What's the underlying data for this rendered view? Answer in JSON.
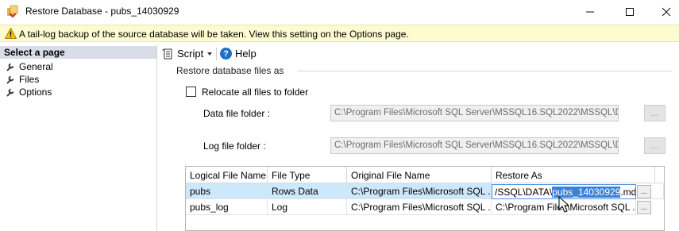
{
  "window": {
    "title": "Restore Database - pubs_14030929",
    "controls": [
      "—",
      "☐",
      "✕"
    ]
  },
  "banner": {
    "text": "A tail-log backup of the source database will be taken. View this setting on the Options page."
  },
  "sidebar": {
    "header": "Select a page",
    "items": [
      {
        "label": "General"
      },
      {
        "label": "Files"
      },
      {
        "label": "Options"
      }
    ]
  },
  "toolbar": {
    "script_label": "Script",
    "help_label": "Help",
    "help_glyph": "?"
  },
  "files_section": {
    "group_label": "Restore database files as",
    "relocate_label": "Relocate all files to folder",
    "relocate_checked": false,
    "data_folder_label": "Data file folder :",
    "data_folder_value": "C:\\Program Files\\Microsoft SQL Server\\MSSQL16.SQL2022\\MSSQL\\DAT.",
    "log_folder_label": "Log file folder :",
    "log_folder_value": "C:\\Program Files\\Microsoft SQL Server\\MSSQL16.SQL2022\\MSSQL\\DAT.",
    "browse_label": "..."
  },
  "grid": {
    "columns": [
      "Logical File Name",
      "File Type",
      "Original File Name",
      "Restore As"
    ],
    "rows": [
      {
        "logical": "pubs",
        "type": "Rows Data",
        "original": "C:\\Program Files\\Microsoft SQL ...",
        "restore_prefix": "/SSQL\\DATA\\",
        "restore_selected": "pubs_14030929",
        "restore_suffix": ".mdf"
      },
      {
        "logical": "pubs_log",
        "type": "Log",
        "original": "C:\\Program Files\\Microsoft SQL ...",
        "restore": "C:\\Program Files\\Microsoft SQL ..."
      }
    ],
    "browse_label": "..."
  },
  "colors": {
    "banner_bg": "#fdfbd0",
    "selected_row": "#cde8fb",
    "selection_highlight": "#3b82d6",
    "sidebar_header": "#d8dde7"
  }
}
